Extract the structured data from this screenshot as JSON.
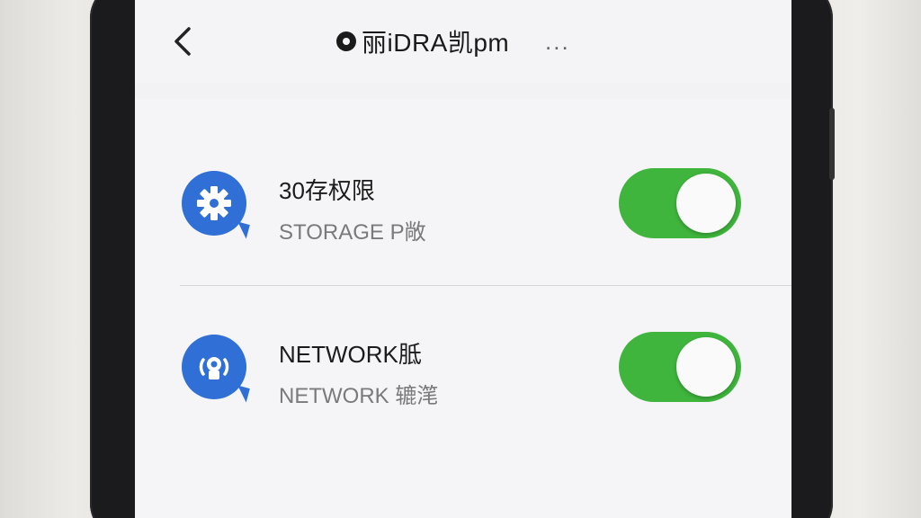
{
  "header": {
    "back_icon": "chevron-left-icon",
    "title": "丽iDRA凯pm",
    "more_label": "..."
  },
  "settings": [
    {
      "icon": "gear-icon",
      "title": "30存权限",
      "subtitle": "STORAGE P敞",
      "toggle_on": true
    },
    {
      "icon": "broadcast-icon",
      "title": "NETWORK胝",
      "subtitle": "NETWORK 辘滗",
      "toggle_on": true
    }
  ],
  "colors": {
    "accent_blue": "#2f6fd6",
    "toggle_on_green": "#3fb53d"
  }
}
